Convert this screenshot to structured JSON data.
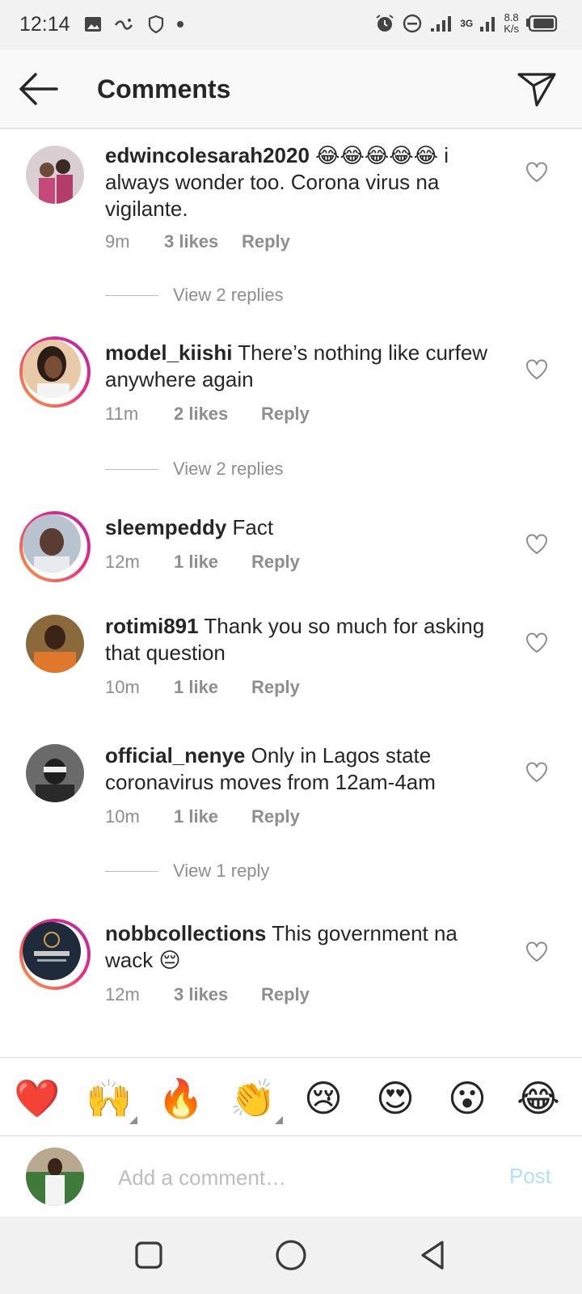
{
  "status_bar": {
    "time": "12:14",
    "network_speed_value": "8.8",
    "network_speed_unit": "K/s",
    "network_type": "3G"
  },
  "header": {
    "title": "Comments"
  },
  "comments": [
    {
      "username": "edwincolesarah2020",
      "text": "😂😂😂😂😂 i always wonder too. Corona virus na vigilante.",
      "time": "9m",
      "likes": "3 likes",
      "reply": "Reply",
      "view_replies": "View 2 replies",
      "story_ring": false
    },
    {
      "username": "model_kiishi",
      "text": "There’s nothing like curfew anywhere again",
      "time": "11m",
      "likes": "2 likes",
      "reply": "Reply",
      "view_replies": "View 2 replies",
      "story_ring": true
    },
    {
      "username": "sleempeddy",
      "text": "Fact",
      "time": "12m",
      "likes": "1 like",
      "reply": "Reply",
      "story_ring": true
    },
    {
      "username": "rotimi891",
      "text": "Thank you so much for asking that question",
      "time": "10m",
      "likes": "1 like",
      "reply": "Reply",
      "story_ring": false
    },
    {
      "username": "official_nenye",
      "text": "Only in Lagos state coronavirus moves from 12am-4am",
      "time": "10m",
      "likes": "1 like",
      "reply": "Reply",
      "view_replies": "View 1 reply",
      "story_ring": false
    },
    {
      "username": "nobbcollections",
      "text": "This government na wack 😔",
      "time": "12m",
      "likes": "3 likes",
      "reply": "Reply",
      "story_ring": true
    }
  ],
  "emoji_bar": [
    "❤️",
    "🙌",
    "🔥",
    "👏",
    "😢",
    "😍",
    "😮",
    "😂"
  ],
  "composer": {
    "placeholder": "Add a comment…",
    "post_label": "Post"
  },
  "colors": {
    "accent_post_disabled": "#b2dffc",
    "secondary_text": "#8e8e8e",
    "primary_text": "#262626"
  }
}
